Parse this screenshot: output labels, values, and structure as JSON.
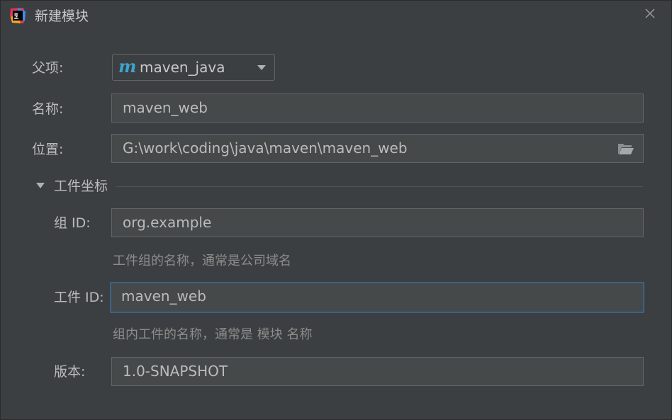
{
  "window": {
    "title": "新建模块"
  },
  "form": {
    "parent": {
      "label": "父项:",
      "value": "maven_java",
      "icon": "maven-icon"
    },
    "name": {
      "label": "名称:",
      "value": "maven_web"
    },
    "location": {
      "label": "位置:",
      "value": "G:\\work\\coding\\java\\maven\\maven_web"
    },
    "artifact_section": {
      "title": "工件坐标",
      "group_id": {
        "label": "组 ID:",
        "value": "org.example",
        "hint": "工件组的名称，通常是公司域名"
      },
      "artifact_id": {
        "label": "工件 ID:",
        "value": "maven_web",
        "hint": "组内工件的名称，通常是 模块 名称"
      },
      "version": {
        "label": "版本:",
        "value": "1.0-SNAPSHOT"
      }
    }
  },
  "colors": {
    "background": "#3c3f41",
    "field_background": "#45494a",
    "field_border": "#646464",
    "focus_border": "#3d6185",
    "maven_icon": "#3fa3cf"
  }
}
